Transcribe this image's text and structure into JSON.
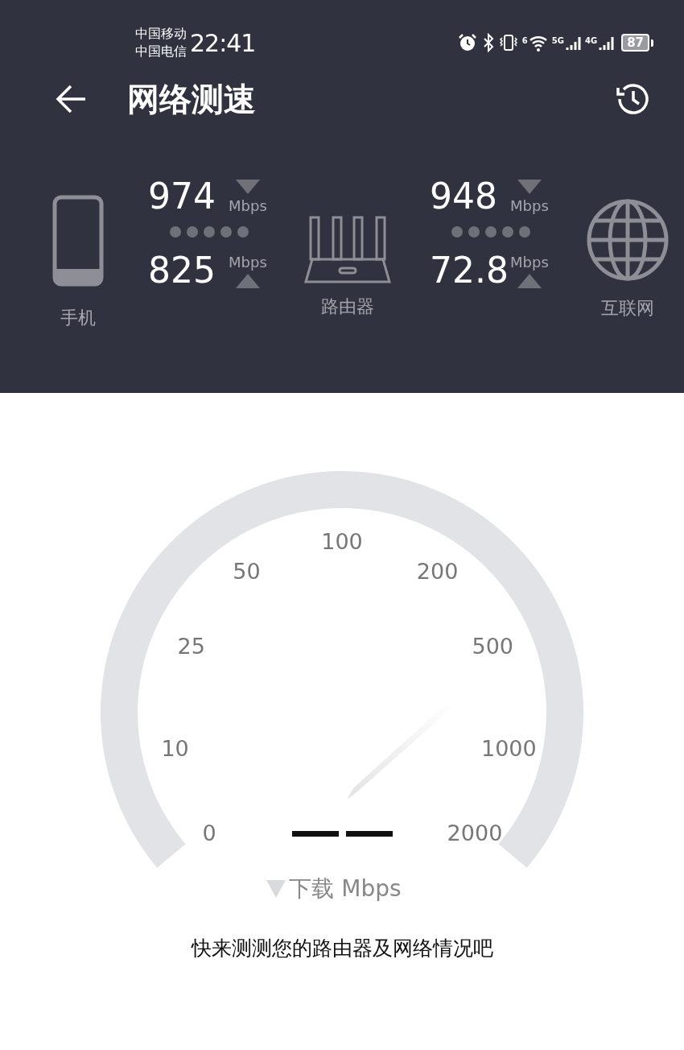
{
  "status_bar": {
    "carriers": [
      "中国移动",
      "中国电信"
    ],
    "time": "22:41",
    "network_labels": [
      "6",
      "5G",
      "4G"
    ],
    "battery": "87"
  },
  "header": {
    "title": "网络测速"
  },
  "devices": [
    {
      "label": "手机",
      "kind": "phone"
    },
    {
      "label": "路由器",
      "kind": "router"
    },
    {
      "label": "互联网",
      "kind": "globe"
    }
  ],
  "links": [
    {
      "download": "974",
      "download_unit": "Mbps",
      "upload": "825",
      "upload_unit": "Mbps"
    },
    {
      "download": "948",
      "download_unit": "Mbps",
      "upload": "72.8",
      "upload_unit": "Mbps"
    }
  ],
  "gauge": {
    "scale_labels": [
      "0",
      "10",
      "25",
      "50",
      "100",
      "200",
      "500",
      "1000",
      "2000"
    ],
    "unit_label": "下载 Mbps"
  },
  "hint": "快来测测您的路由器及网络情况吧"
}
